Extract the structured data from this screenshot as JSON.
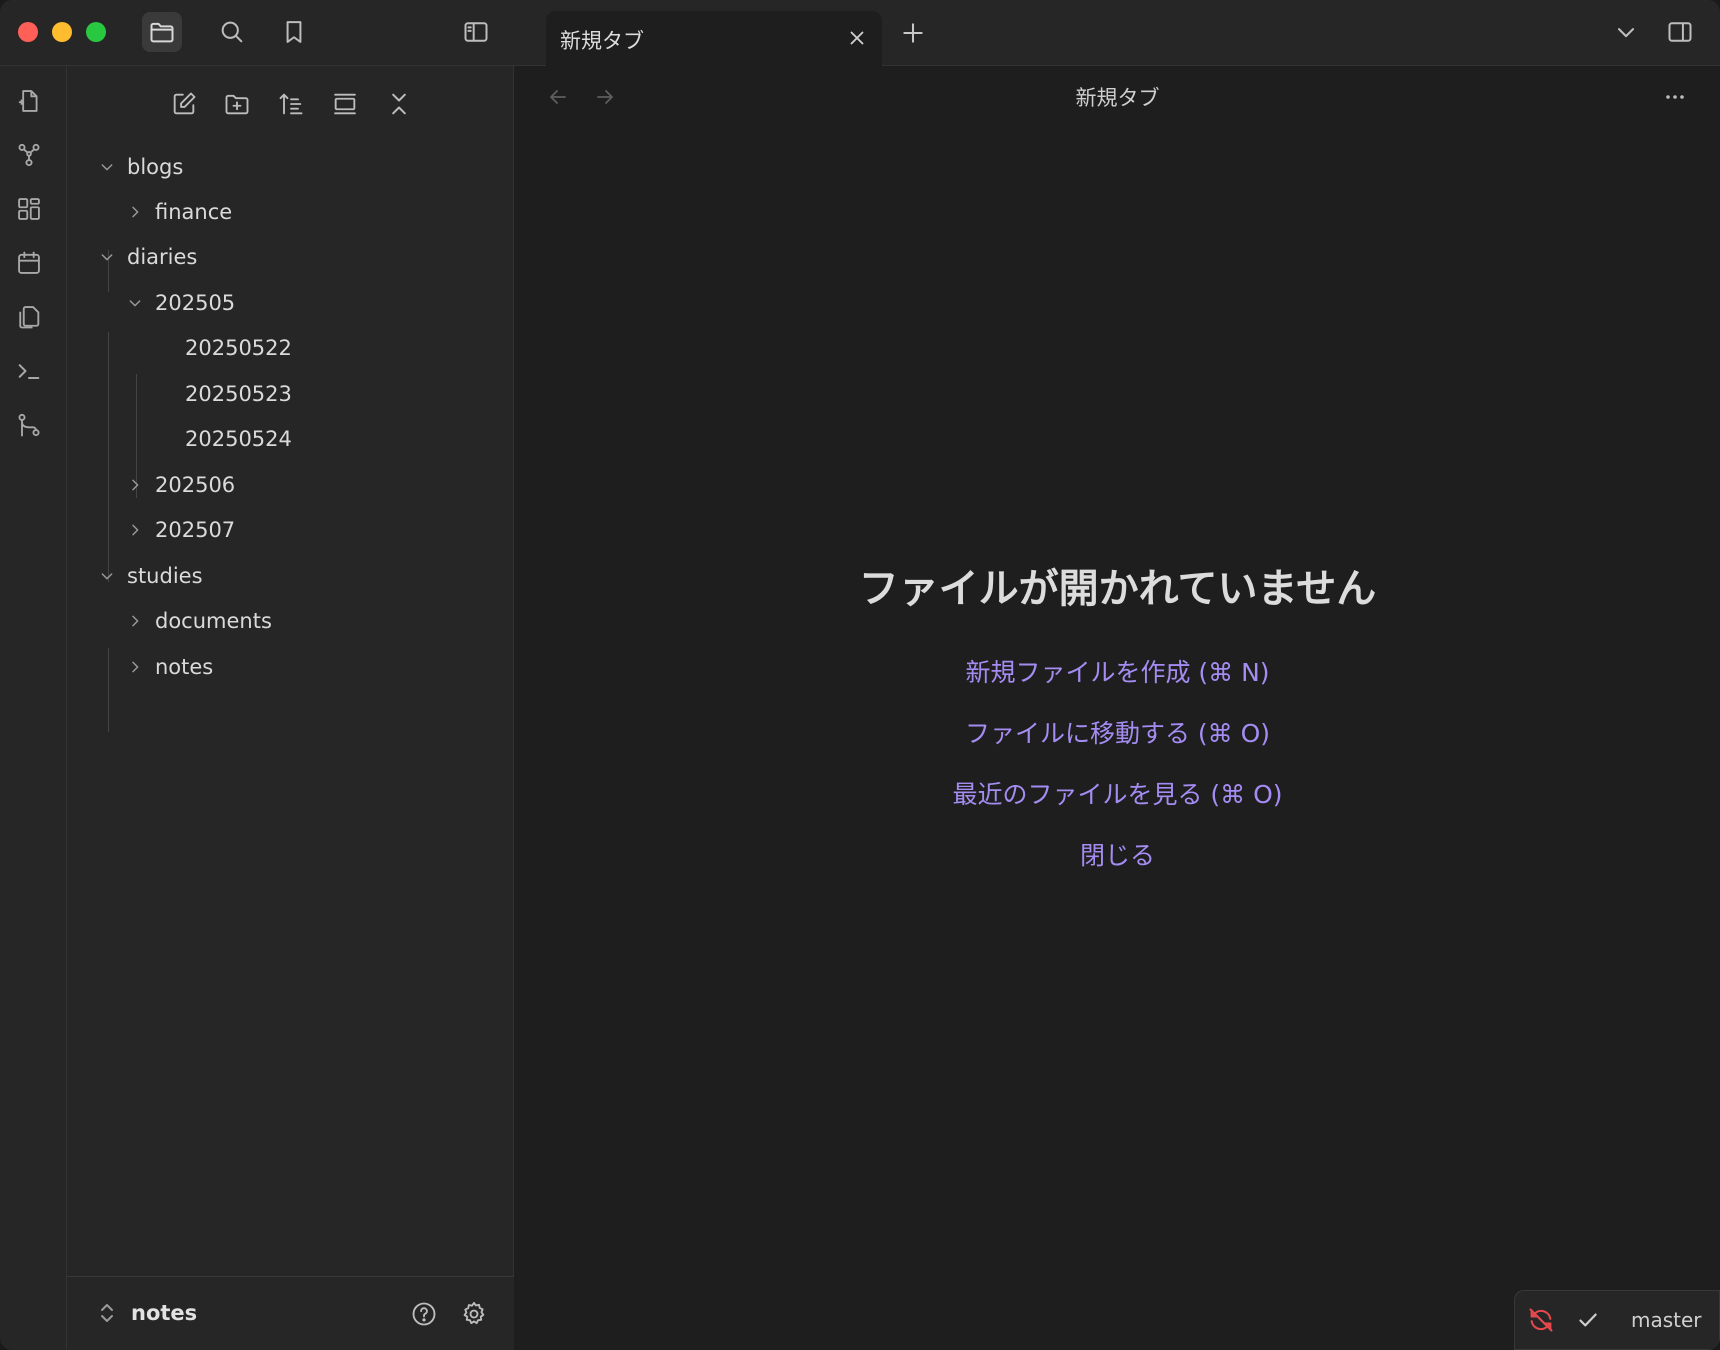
{
  "window": {
    "titlebar": {
      "tab_title": "新規タブ"
    },
    "icons": {
      "files": "folder-icon",
      "search": "search-icon",
      "bookmarks": "bookmark-icon",
      "toggle_left_sidebar": "sidebar-left-icon",
      "tab_list": "chevron-down-icon",
      "toggle_right_sidebar": "sidebar-right-icon"
    }
  },
  "ribbon": {
    "items": [
      "open-quick-switcher-icon",
      "graph-view-icon",
      "canvas-icon",
      "calendar-icon",
      "templates-icon",
      "command-palette-icon",
      "git-icon"
    ]
  },
  "sidebar": {
    "toolbar": [
      "new-note-icon",
      "new-folder-icon",
      "sort-icon",
      "collapse-view-icon",
      "collapse-all-icon"
    ],
    "tree": [
      {
        "label": "blogs",
        "level": 0,
        "state": "expanded"
      },
      {
        "label": "finance",
        "level": 1,
        "state": "collapsed"
      },
      {
        "label": "diaries",
        "level": 0,
        "state": "expanded"
      },
      {
        "label": "202505",
        "level": 1,
        "state": "expanded"
      },
      {
        "label": "20250522",
        "level": 2,
        "state": "file"
      },
      {
        "label": "20250523",
        "level": 2,
        "state": "file"
      },
      {
        "label": "20250524",
        "level": 2,
        "state": "file"
      },
      {
        "label": "202506",
        "level": 1,
        "state": "collapsed"
      },
      {
        "label": "202507",
        "level": 1,
        "state": "collapsed"
      },
      {
        "label": "studies",
        "level": 0,
        "state": "expanded"
      },
      {
        "label": "documents",
        "level": 1,
        "state": "collapsed"
      },
      {
        "label": "notes",
        "level": 1,
        "state": "collapsed"
      }
    ],
    "footer": {
      "vault_name": "notes"
    }
  },
  "main": {
    "header_title": "新規タブ",
    "empty_state": {
      "title": "ファイルが開かれていません",
      "actions": [
        "新規ファイルを作成 (⌘ N)",
        "ファイルに移動する (⌘ O)",
        "最近のファイルを見る (⌘ O)",
        "閉じる"
      ]
    }
  },
  "statusbar": {
    "branch": "master"
  },
  "colors": {
    "accent": "#a48cf2",
    "sync_error": "#e5484d",
    "background": "#1e1e1e",
    "sidebar": "#262626"
  }
}
